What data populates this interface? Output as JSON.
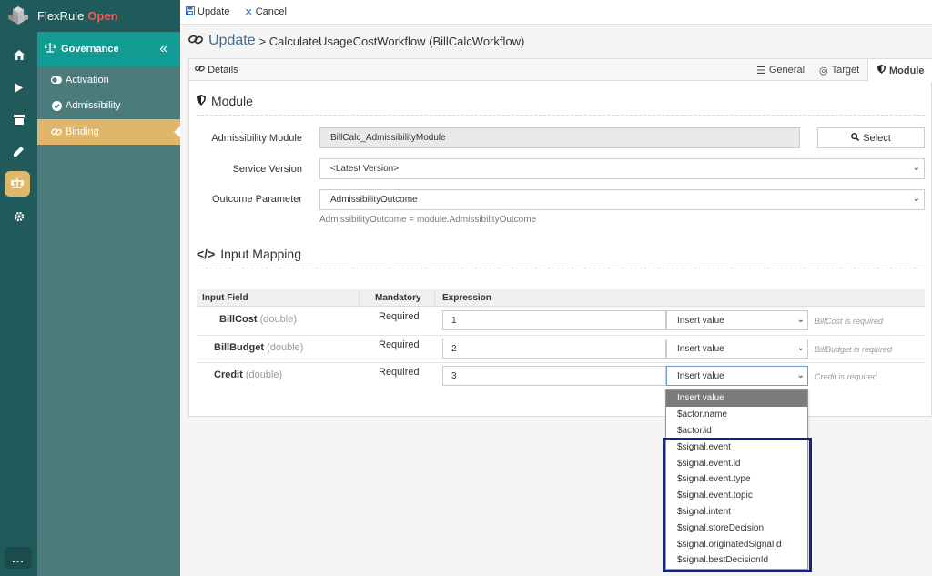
{
  "app": {
    "brand": "FlexRule",
    "brand_suffix": "Open"
  },
  "rail_icons": [
    "home-icon",
    "play-icon",
    "archive-icon",
    "pencil-icon",
    "governance-icon",
    "gear-icon"
  ],
  "rail_more": "...",
  "sidebar": {
    "section": "Governance",
    "collapse": "«",
    "items": [
      {
        "label": "Activation"
      },
      {
        "label": "Admissibility"
      },
      {
        "label": "Binding"
      }
    ]
  },
  "toolbar": {
    "update_label": "Update",
    "cancel_label": "Cancel"
  },
  "page": {
    "action": "Update",
    "title": "> CalculateUsageCostWorkflow (BillCalcWorkflow)"
  },
  "tabs": {
    "details": "Details",
    "general": "General",
    "target": "Target",
    "module": "Module"
  },
  "module_section": {
    "title": "Module",
    "admissibility_label": "Admissibility Module",
    "admissibility_value": "BillCalc_AdmissibilityModule",
    "select_label": "Select",
    "service_version_label": "Service Version",
    "service_version_value": "<Latest Version>",
    "outcome_label": "Outcome Parameter",
    "outcome_value": "AdmissibilityOutcome",
    "outcome_hint": "AdmissibilityOutcome = module.AdmissibilityOutcome"
  },
  "mapping": {
    "title": "Input Mapping",
    "headers": {
      "field": "Input Field",
      "mandatory": "Mandatory",
      "expression": "Expression"
    },
    "rows": [
      {
        "name": "BillCost",
        "type": "(double)",
        "mandatory": "Required",
        "expr": "1",
        "insert": "Insert value",
        "msg": "BillCost is required"
      },
      {
        "name": "BillBudget",
        "type": "(double)",
        "mandatory": "Required",
        "expr": "2",
        "insert": "Insert value",
        "msg": "BillBudget is required"
      },
      {
        "name": "Credit",
        "type": "(double)",
        "mandatory": "Required",
        "expr": "3",
        "insert": "Insert value",
        "msg": "Credit is required"
      }
    ]
  },
  "dropdown": {
    "options": [
      "Insert value",
      "$actor.name",
      "$actor.id",
      "$signal.event",
      "$signal.event.id",
      "$signal.event.type",
      "$signal.event.topic",
      "$signal.intent",
      "$signal.storeDecision",
      "$signal.originatedSignalId",
      "$signal.bestDecisionId"
    ]
  },
  "colors": {
    "rail": "#215a5a",
    "sidebar": "#4b7c7b",
    "section": "#119b92",
    "active": "#e0b66a",
    "highlight_box": "#1a237e"
  }
}
